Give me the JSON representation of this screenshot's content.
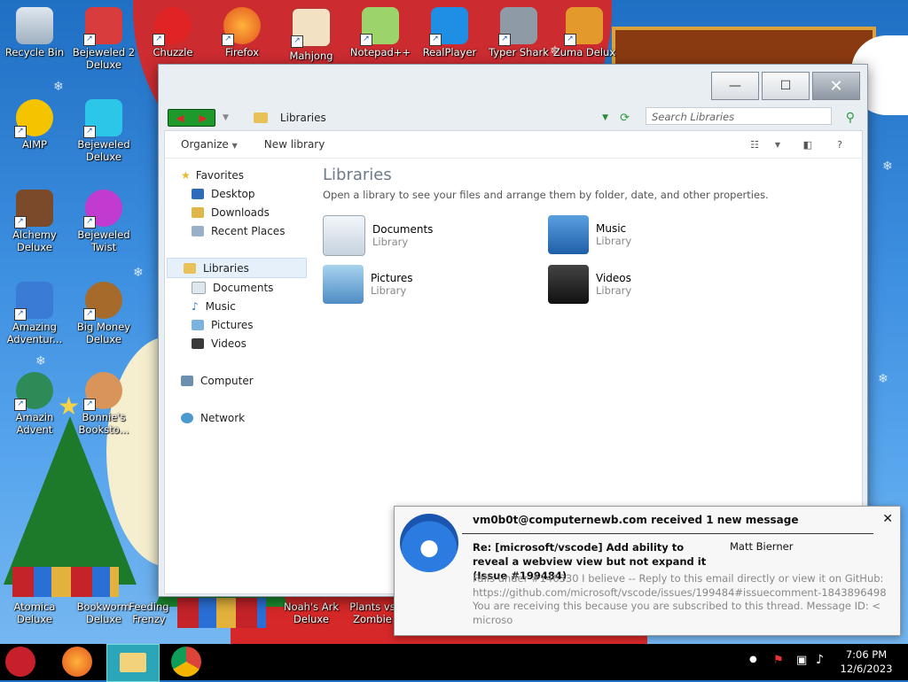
{
  "desktop": {
    "icons": [
      {
        "label": "Recycle Bin"
      },
      {
        "label": "Bejeweled 2 Deluxe"
      },
      {
        "label": "Chuzzle"
      },
      {
        "label": "Firefox"
      },
      {
        "label": "Mahjong"
      },
      {
        "label": "Notepad++"
      },
      {
        "label": "RealPlayer"
      },
      {
        "label": "Typer Shark"
      },
      {
        "label": "Zuma Delux"
      },
      {
        "label": "AIMP"
      },
      {
        "label": "Bejeweled Deluxe"
      },
      {
        "label": "Alchemy Deluxe"
      },
      {
        "label": "Bejeweled Twist"
      },
      {
        "label": "Amazing Adventur..."
      },
      {
        "label": "Big Money Deluxe"
      },
      {
        "label": "Amazin Advent"
      },
      {
        "label": "Bonnie's Booksto..."
      },
      {
        "label": "Atomica Deluxe"
      },
      {
        "label": "Bookworm Deluxe"
      },
      {
        "label": "Feeding Frenzy"
      },
      {
        "label": "Noah's Ark Deluxe"
      },
      {
        "label": "Plants vs Zombie"
      }
    ]
  },
  "explorer": {
    "address": "Libraries",
    "search_placeholder": "Search Libraries",
    "toolbar": {
      "organize": "Organize",
      "new_library": "New library",
      "help": "?"
    },
    "nav": {
      "favorites": "Favorites",
      "desktop": "Desktop",
      "downloads": "Downloads",
      "recent": "Recent Places",
      "libraries": "Libraries",
      "documents": "Documents",
      "music": "Music",
      "pictures": "Pictures",
      "videos": "Videos",
      "computer": "Computer",
      "network": "Network"
    },
    "heading": "Libraries",
    "subheading": "Open a library to see your files and arrange them by folder, date, and other properties.",
    "libraries": [
      {
        "name": "Documents",
        "type": "Library"
      },
      {
        "name": "Music",
        "type": "Library"
      },
      {
        "name": "Pictures",
        "type": "Library"
      },
      {
        "name": "Videos",
        "type": "Library"
      }
    ]
  },
  "notification": {
    "header": "vm0b0t@computernewb.com received 1 new message",
    "subject": "Re: [microsoft/vscode] Add ability to reveal a webview view but not expand it (Issue #199484)",
    "sender": "Matt Bierner",
    "body": "Falls under #146330 I believe -- Reply to this email directly or view it on GitHub: https://github.com/microsoft/vscode/issues/199484#issuecomment-1843896498 You are receiving this because you are subscribed to this thread. Message ID: <microso",
    "close": "✕"
  },
  "taskbar": {
    "time": "7:06 PM",
    "date": "12/6/2023"
  }
}
